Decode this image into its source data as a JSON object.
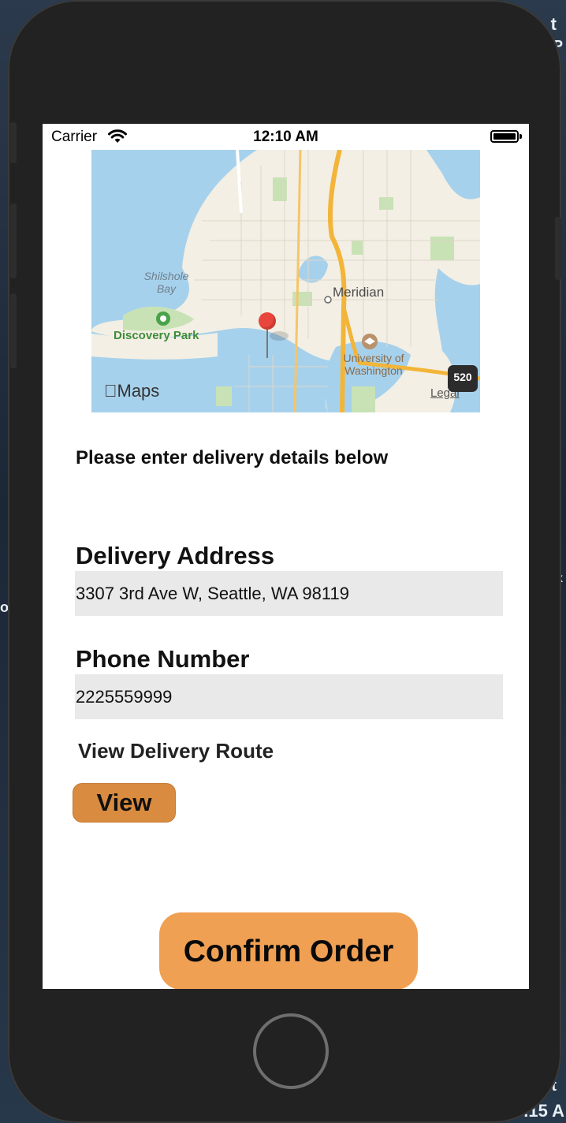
{
  "desktop": {
    "fragments": [
      "t",
      "P",
      "o",
      "x",
      "t",
      ".15 A"
    ]
  },
  "status_bar": {
    "carrier": "Carrier",
    "time": "12:10 AM",
    "wifi_icon": "wifi-icon",
    "battery_icon": "battery-full-icon"
  },
  "map": {
    "labels": {
      "shilshole": "Shilshole Bay",
      "discovery_park": "Discovery Park",
      "meridian": "Meridian",
      "university": "University of Washington",
      "legal": "Legal",
      "route": "520"
    },
    "logo": "Maps",
    "pin_icon": "map-pin-icon"
  },
  "form": {
    "prompt": "Please enter delivery details below",
    "address_label": "Delivery Address",
    "address_value": "3307 3rd Ave W, Seattle, WA 98119",
    "phone_label": "Phone Number",
    "phone_value": "2225559999",
    "route_label": "View Delivery Route",
    "view_button": "View",
    "confirm_button": "Confirm Order"
  },
  "colors": {
    "accent_button": "#d98b3f",
    "confirm_button": "#f0a053",
    "input_background": "#e9e9e9",
    "pin": "#e8453c"
  }
}
